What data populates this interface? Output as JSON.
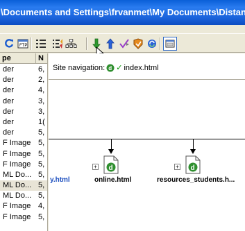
{
  "window": {
    "title": "\\Documents and Settings\\frvanmet\\My Documents\\Distance"
  },
  "file_list": {
    "headers": {
      "type": "pe",
      "size": "N"
    },
    "rows": [
      {
        "type": "der",
        "size": "6,"
      },
      {
        "type": "der",
        "size": "2,"
      },
      {
        "type": "der",
        "size": "4,"
      },
      {
        "type": "der",
        "size": "3,"
      },
      {
        "type": "der",
        "size": "3,"
      },
      {
        "type": "der",
        "size": "1("
      },
      {
        "type": "der",
        "size": "5,"
      },
      {
        "type": "F Image",
        "size": "5,"
      },
      {
        "type": "F Image",
        "size": "5,"
      },
      {
        "type": "F Image",
        "size": "5,"
      },
      {
        "type": "ML Do...",
        "size": "5,"
      },
      {
        "type": "ML Do...",
        "size": "5,"
      },
      {
        "type": "ML Do...",
        "size": "5,"
      },
      {
        "type": "F Image",
        "size": "4,"
      },
      {
        "type": "F Image",
        "size": "5,"
      }
    ],
    "selected_row": 11
  },
  "site_map": {
    "nav_label": "Site navigation:",
    "home_file": "index.html",
    "children": [
      {
        "label": "y.html",
        "truncated_left": true
      },
      {
        "label": "online.html"
      },
      {
        "label": "resources_students.h..."
      }
    ]
  },
  "toolbar": {
    "icons": [
      "refresh-icon",
      "ftp-icon",
      "list-view-icon",
      "site-files-icon",
      "site-map-icon",
      "get-arrow-icon",
      "put-arrow-icon",
      "check-out-icon",
      "check-in-icon",
      "synchronize-icon",
      "expand-panel-icon"
    ]
  },
  "colors": {
    "title_bar": "#1b64dc",
    "panel_bg": "#ece9d8",
    "link_blue": "#1d4fbf",
    "dreamweaver_green": "#2f8f2f"
  }
}
